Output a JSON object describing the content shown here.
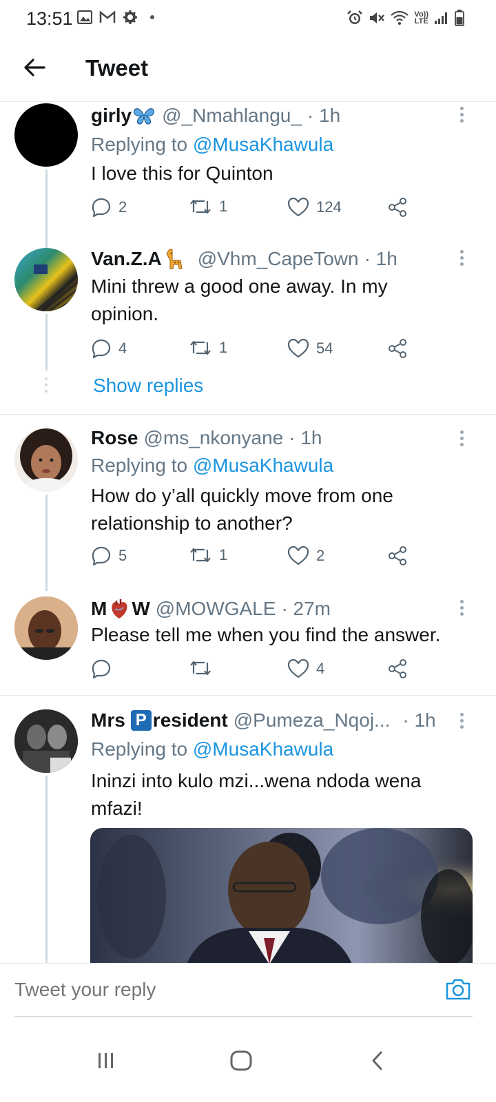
{
  "status_bar": {
    "time": "13:51",
    "left_icons": [
      "gallery-icon",
      "gmail-icon",
      "settings-icon",
      "dot-icon"
    ],
    "right_icons": [
      "alarm-icon",
      "mute-icon",
      "wifi-icon",
      "volte-icon",
      "signal-icon",
      "battery-icon"
    ],
    "volte_label_top": "Vo))",
    "volte_label_bottom": "LTE"
  },
  "header": {
    "title": "Tweet",
    "back_icon": "arrow-left-icon"
  },
  "colors": {
    "link": "#1b95e0",
    "text": "#14171a",
    "secondary": "#657786",
    "divider": "#e1e8ed"
  },
  "tweets": [
    {
      "name": "girly",
      "name_emoji": "🦋",
      "handle": "@_Nmahlangu_",
      "time": "· 1h",
      "replying_prefix": "Replying to",
      "replying_to": "@MusaKhawula",
      "text": "I love this for Quinton",
      "replies": "2",
      "retweets": "1",
      "likes": "124"
    },
    {
      "name": "Van.Z.A",
      "name_emoji": "🦒",
      "handle": "@Vhm_CapeTown",
      "time": "· 1h",
      "text": "Mini threw a good one away. In my opinion.",
      "replies": "4",
      "retweets": "1",
      "likes": "54",
      "show_replies": "Show replies"
    },
    {
      "name": "Rose",
      "handle": "@ms_nkonyane",
      "time": "· 1h",
      "replying_prefix": "Replying to",
      "replying_to": "@MusaKhawula",
      "text": "How do y’all quickly move from one relationship to another?",
      "replies": "5",
      "retweets": "1",
      "likes": "2"
    },
    {
      "name_left": "M",
      "name_emoji": "🫀",
      "name_right": "W",
      "handle": "@MOWGALE",
      "time": "· 27m",
      "text": "Please tell me when you find the answer.",
      "replies": "",
      "retweets": "",
      "likes": "4"
    },
    {
      "name_left": "Mrs",
      "name_badge": "P",
      "name_right": "resident",
      "handle": "@Pumeza_Nqoj...",
      "time": "· 1h",
      "replying_prefix": "Replying to",
      "replying_to": "@MusaKhawula",
      "text": "Ininzi into kulo mzi...wena ndoda wena mfazi!"
    }
  ],
  "reply_bar": {
    "placeholder": "Tweet your reply",
    "camera_icon": "camera-icon"
  },
  "nav_bar": {
    "buttons": [
      "recent-apps-icon",
      "home-icon",
      "back-icon"
    ]
  }
}
